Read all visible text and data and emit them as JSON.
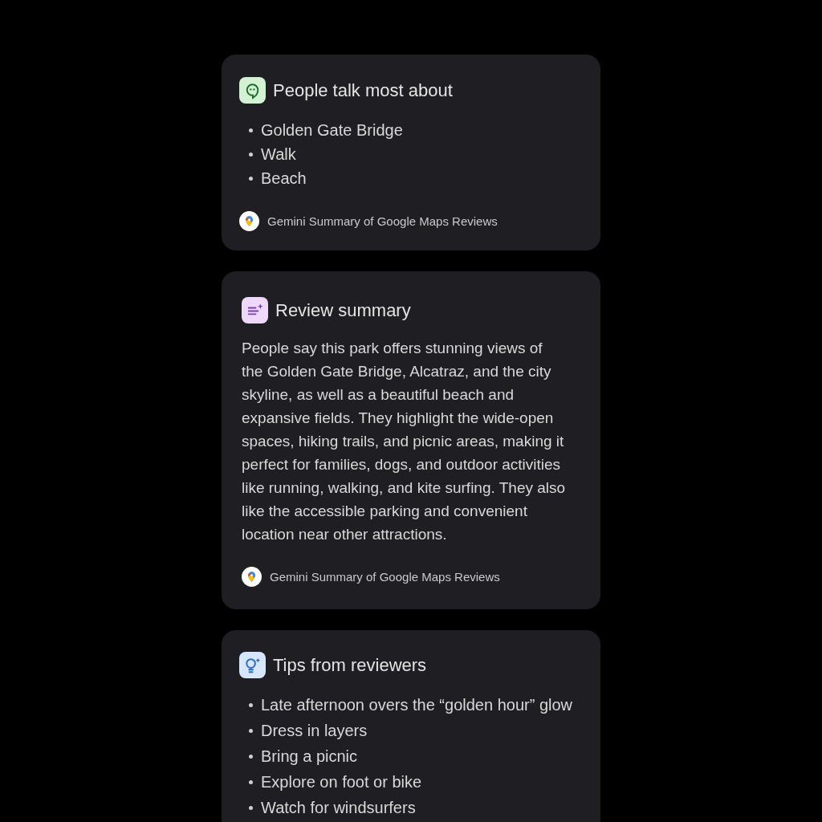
{
  "cards": [
    {
      "kind": "topics",
      "title": "People talk most about",
      "items": [
        "Golden Gate Bridge",
        "Walk",
        "Beach"
      ],
      "footer": "Gemini Summary of Google Maps Reviews"
    },
    {
      "kind": "summary",
      "title": "Review summary",
      "text": "People say this park offers stunning views of the Golden Gate Bridge, Alcatraz, and the city skyline, as well as a beautiful beach and expansive fields. They highlight the wide-open spaces, hiking trails, and picnic areas, making it perfect for families, dogs, and outdoor activities like running, walking, and kite surfing. They also like the accessible parking and convenient location near other attractions.",
      "footer": "Gemini Summary of Google Maps Reviews"
    },
    {
      "kind": "tips",
      "title": "Tips from reviewers",
      "items": [
        "Late afternoon overs the “golden hour” glow",
        "Dress in layers",
        "Bring a picnic",
        "Explore on foot or bike",
        "Watch for windsurfers"
      ]
    }
  ]
}
